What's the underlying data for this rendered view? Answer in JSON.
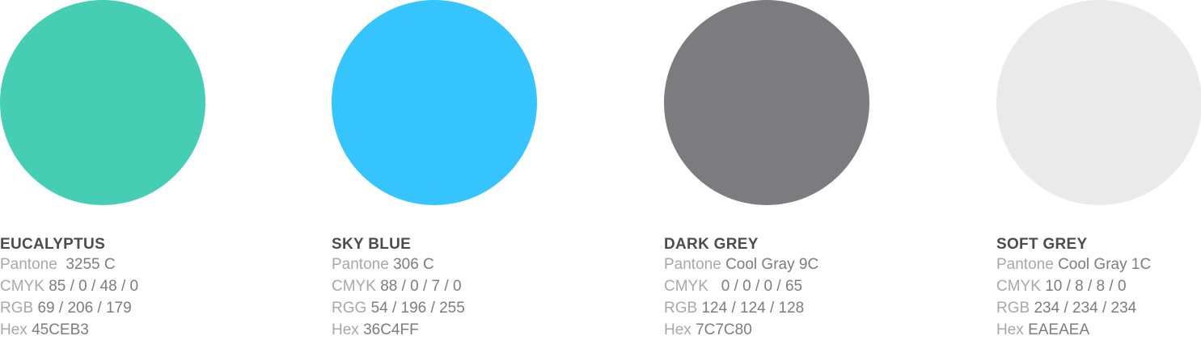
{
  "swatches": [
    {
      "name": "EUCALYPTUS",
      "color": "#45CEB3",
      "specs": [
        {
          "label": "Pantone",
          "value": " 3255 C"
        },
        {
          "label": "CMYK",
          "value": "85 / 0 / 48 / 0"
        },
        {
          "label": "RGB",
          "value": "69 / 206 / 179"
        },
        {
          "label": "Hex",
          "value": "45CEB3"
        }
      ]
    },
    {
      "name": "SKY BLUE",
      "color": "#36C4FF",
      "specs": [
        {
          "label": "Pantone",
          "value": "306 C"
        },
        {
          "label": "CMYK",
          "value": "88 / 0 / 7 / 0"
        },
        {
          "label": "RGG",
          "value": "54 / 196 / 255"
        },
        {
          "label": "Hex",
          "value": "36C4FF"
        }
      ]
    },
    {
      "name": "DARK GREY",
      "color": "#7C7C80",
      "specs": [
        {
          "label": "Pantone",
          "value": "Cool Gray 9C"
        },
        {
          "label": "CMYK",
          "value": "  0 / 0 / 0 / 65"
        },
        {
          "label": "RGB",
          "value": "124 / 124 / 128"
        },
        {
          "label": "Hex",
          "value": "7C7C80"
        }
      ]
    },
    {
      "name": "SOFT GREY",
      "color": "#EAEAEA",
      "specs": [
        {
          "label": "Pantone",
          "value": "Cool Gray 1C"
        },
        {
          "label": "CMYK",
          "value": "10 / 8 / 8 / 0"
        },
        {
          "label": "RGB",
          "value": "234 / 234 / 234"
        },
        {
          "label": "Hex",
          "value": "EAEAEA"
        }
      ]
    }
  ]
}
